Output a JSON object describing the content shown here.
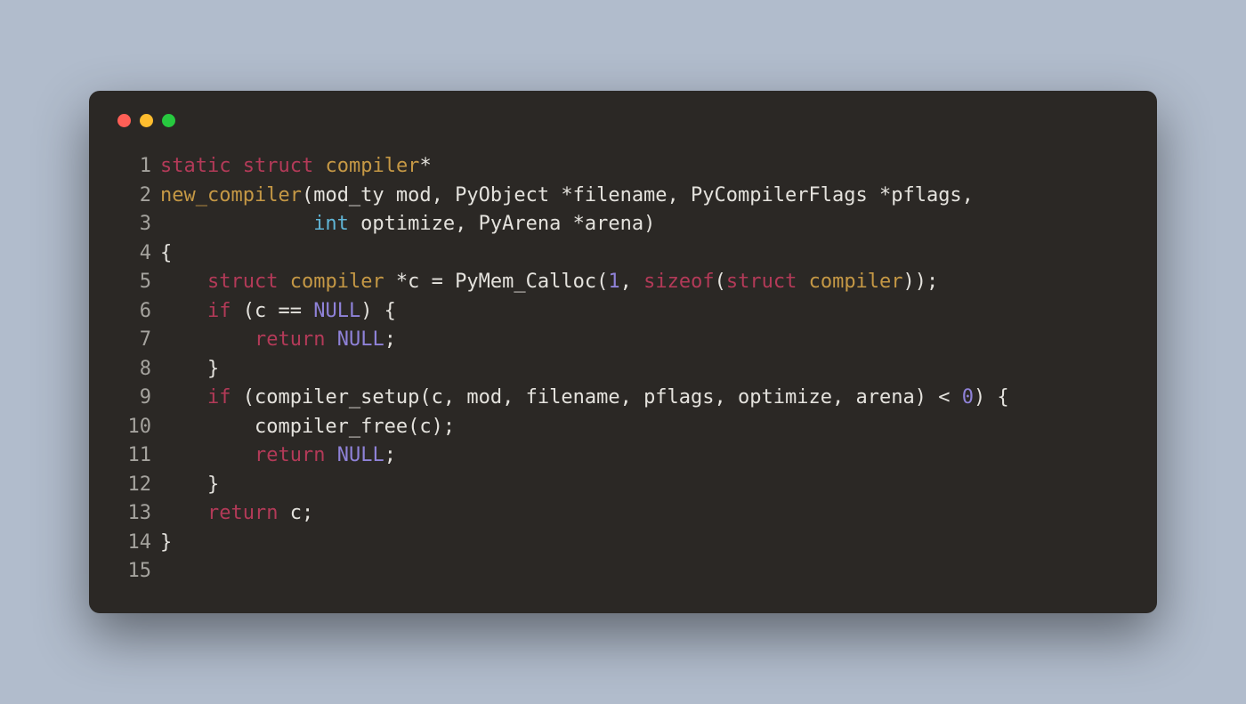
{
  "colors": {
    "bg_page": "#b1bccc",
    "bg_window": "#2b2825",
    "text": "#e4e2dd",
    "lineno": "#a5a39e",
    "kw": "#b33a58",
    "type": "#60b5d6",
    "typename": "#c59845",
    "const": "#8f82d8",
    "traffic_red": "#ff5f56",
    "traffic_yellow": "#ffbd2e",
    "traffic_green": "#27c93f"
  },
  "lines": [
    {
      "n": "1",
      "tokens": [
        [
          "kw",
          "static"
        ],
        [
          "op",
          " "
        ],
        [
          "kw",
          "struct"
        ],
        [
          "op",
          " "
        ],
        [
          "typename",
          "compiler"
        ],
        [
          "op",
          "*"
        ]
      ]
    },
    {
      "n": "2",
      "tokens": [
        [
          "typename",
          "new_compiler"
        ],
        [
          "op",
          "(mod_ty mod, PyObject *filename, PyCompilerFlags *pflags,"
        ]
      ]
    },
    {
      "n": "3",
      "tokens": [
        [
          "op",
          "             "
        ],
        [
          "type",
          "int"
        ],
        [
          "op",
          " optimize, PyArena *arena)"
        ]
      ]
    },
    {
      "n": "4",
      "tokens": [
        [
          "op",
          "{"
        ]
      ]
    },
    {
      "n": "5",
      "tokens": [
        [
          "op",
          "    "
        ],
        [
          "kw",
          "struct"
        ],
        [
          "op",
          " "
        ],
        [
          "typename",
          "compiler"
        ],
        [
          "op",
          " *c = PyMem_Calloc("
        ],
        [
          "num",
          "1"
        ],
        [
          "op",
          ", "
        ],
        [
          "kw",
          "sizeof"
        ],
        [
          "op",
          "("
        ],
        [
          "kw",
          "struct"
        ],
        [
          "op",
          " "
        ],
        [
          "typename",
          "compiler"
        ],
        [
          "op",
          "));"
        ]
      ]
    },
    {
      "n": "6",
      "tokens": [
        [
          "op",
          "    "
        ],
        [
          "kw",
          "if"
        ],
        [
          "op",
          " (c == "
        ],
        [
          "const",
          "NULL"
        ],
        [
          "op",
          ") {"
        ]
      ]
    },
    {
      "n": "7",
      "tokens": [
        [
          "op",
          "        "
        ],
        [
          "kw",
          "return"
        ],
        [
          "op",
          " "
        ],
        [
          "const",
          "NULL"
        ],
        [
          "op",
          ";"
        ]
      ]
    },
    {
      "n": "8",
      "tokens": [
        [
          "op",
          "    }"
        ]
      ]
    },
    {
      "n": "9",
      "tokens": [
        [
          "op",
          "    "
        ],
        [
          "kw",
          "if"
        ],
        [
          "op",
          " (compiler_setup(c, mod, filename, pflags, optimize, arena) < "
        ],
        [
          "num",
          "0"
        ],
        [
          "op",
          ") {"
        ]
      ]
    },
    {
      "n": "10",
      "tokens": [
        [
          "op",
          "        compiler_free(c);"
        ]
      ]
    },
    {
      "n": "11",
      "tokens": [
        [
          "op",
          "        "
        ],
        [
          "kw",
          "return"
        ],
        [
          "op",
          " "
        ],
        [
          "const",
          "NULL"
        ],
        [
          "op",
          ";"
        ]
      ]
    },
    {
      "n": "12",
      "tokens": [
        [
          "op",
          "    }"
        ]
      ]
    },
    {
      "n": "13",
      "tokens": [
        [
          "op",
          "    "
        ],
        [
          "kw",
          "return"
        ],
        [
          "op",
          " c;"
        ]
      ]
    },
    {
      "n": "14",
      "tokens": [
        [
          "op",
          "}"
        ]
      ]
    },
    {
      "n": "15",
      "tokens": [
        [
          "op",
          ""
        ]
      ]
    }
  ]
}
